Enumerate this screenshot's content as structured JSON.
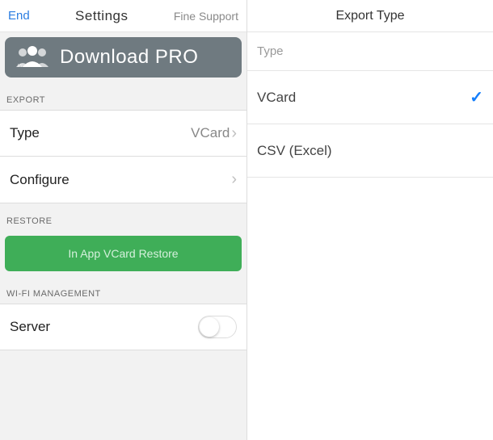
{
  "left": {
    "nav": {
      "end": "End",
      "title": "Settings",
      "right": "Fine Support"
    },
    "download_pro": "Download PRO",
    "export_header": "EXPORT",
    "type_row": {
      "label": "Type",
      "value": "VCard"
    },
    "configure_row": {
      "label": "Configure"
    },
    "restore_header": "RESTORE",
    "restore_btn": "In App VCard Restore",
    "wifi_header": "WI-FI MANAGEMENT",
    "server_row": {
      "label": "Server"
    }
  },
  "right": {
    "title": "Export Type",
    "type_header": "Type",
    "options": [
      {
        "label": "VCard",
        "selected": true
      },
      {
        "label": "CSV (Excel)",
        "selected": false
      }
    ]
  }
}
